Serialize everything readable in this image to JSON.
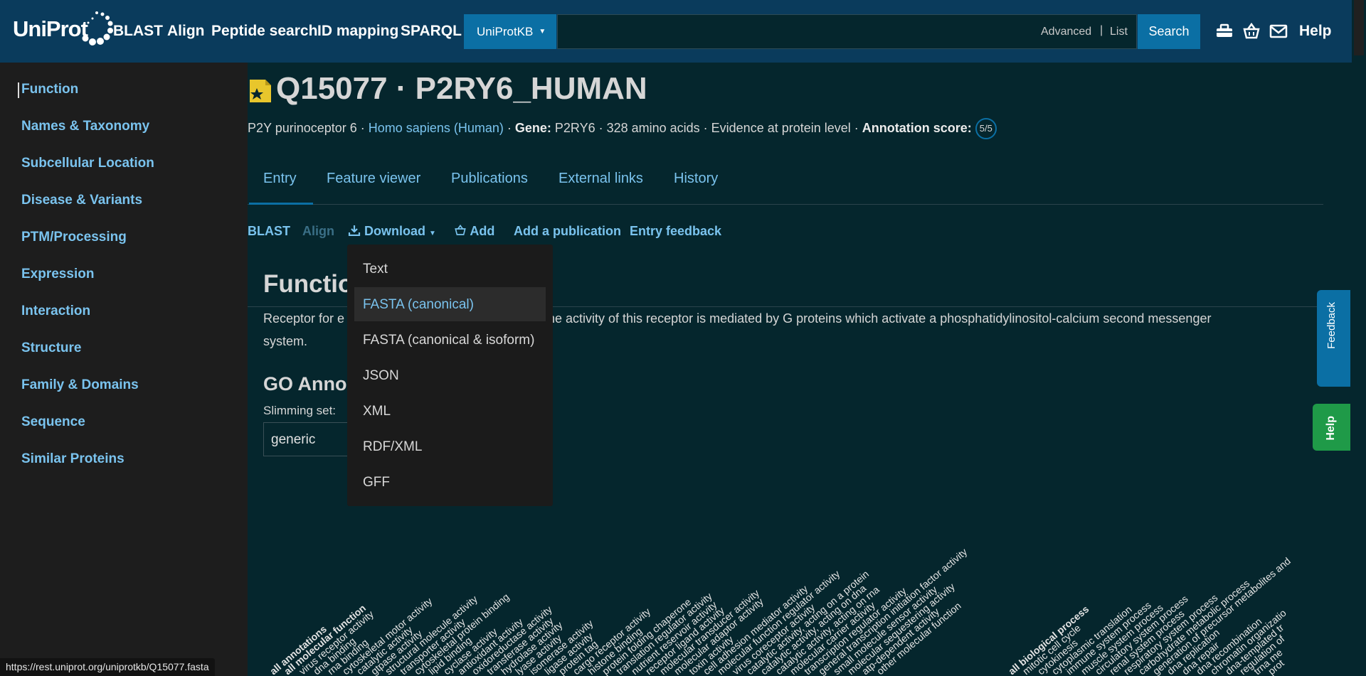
{
  "topbar": {
    "logo_text": "UniProt",
    "nav": [
      "BLAST",
      "Align",
      "Peptide search",
      "ID mapping",
      "SPARQL"
    ],
    "database_select": "UniProtKB",
    "search_value": "",
    "advanced_label": "Advanced",
    "separator": "|",
    "list_label": "List",
    "search_button": "Search",
    "icons": [
      "toolkit-icon",
      "basket-icon",
      "mail-icon"
    ],
    "help_label": "Help"
  },
  "sidebar": {
    "items": [
      "Function",
      "Names & Taxonomy",
      "Subcellular Location",
      "Disease & Variants",
      "PTM/Processing",
      "Expression",
      "Interaction",
      "Structure",
      "Family & Domains",
      "Sequence",
      "Similar Proteins"
    ]
  },
  "entry": {
    "title": "Q15077 · P2RY6_HUMAN",
    "protein_name": "P2Y purinoceptor 6 · ",
    "organism": "Homo sapiens (Human)",
    "gene_prefix": " · ",
    "gene_label": "Gene:",
    "gene_value": " P2RY6 · 328 amino acids · Evidence at protein level · ",
    "annotation_label": "Annotation score:",
    "annotation_score": "5/5"
  },
  "tabs": [
    "Entry",
    "Feature viewer",
    "Publications",
    "External links",
    "History"
  ],
  "toolbar": {
    "blast": "BLAST",
    "align": "Align",
    "download": "Download",
    "add": "Add",
    "add_publication": "Add a publication",
    "entry_feedback": "Entry feedback"
  },
  "download_menu": {
    "items": [
      "Text",
      "FASTA (canonical)",
      "FASTA (canonical & isoform)",
      "JSON",
      "XML",
      "RDF/XML",
      "GFF"
    ],
    "highlighted": "FASTA (canonical)"
  },
  "function": {
    "heading": "Functio",
    "text_part1": "Receptor for e",
    "text_part2": "ne activity of this receptor is mediated by G proteins which activate a phosphatidylinositol-calcium second messenger",
    "text_part3": "system."
  },
  "go": {
    "heading": "GO Anno",
    "slimming_label": "Slimming set:",
    "slimming_value": "generic",
    "labels_mf": [
      "all annotations",
      "all molecular function",
      "virus receptor activity",
      "dna binding",
      "rna binding",
      "cytoskeletal motor activity",
      "catalytic activity",
      "gtpase activity",
      "structural molecule activity",
      "transporter activity",
      "cytoskeletal protein binding",
      "lipid binding",
      "cyclase activity",
      "antioxidant activity",
      "oxidoreductase activity",
      "transferase activity",
      "hydrolase activity",
      "lyase activity",
      "isomerase activity",
      "ligase activity",
      "protein tag",
      "cargo receptor activity",
      "histone binding",
      "protein folding chaperone",
      "translation regulator activity",
      "nutrient reservoir activity",
      "receptor ligand activity",
      "molecular transducer activity",
      "molecular adaptor activity",
      "toxin activity",
      "cell adhesion mediator activity",
      "molecular function regulator activity",
      "virus coreceptor activity",
      "catalytic activity, acting on a protein",
      "catalytic activity, acting on dna",
      "catalytic activity, acting on rna",
      "molecular carrier activity",
      "transcription regulator activity",
      "general transcription initiation factor activity",
      "small molecule sensor activity",
      "molecular sequestering activity",
      "atp-dependent activity",
      "other molecular function"
    ],
    "labels_bp": [
      "all biological process",
      "mitotic cell cycle",
      "cytokinesis",
      "cytoplasmic translation",
      "immune system process",
      "muscle system process",
      "circulatory system process",
      "renal system process",
      "respiratory system process",
      "carbohydrate metabolic process",
      "generation of precursor metabolites and",
      "dna replication",
      "dna repair",
      "dna recombination",
      "chromatin organizatio",
      "dna-templated tr",
      "regulation of",
      "trna me",
      "prot"
    ]
  },
  "side_tabs": {
    "feedback": "Feedback",
    "help": "Help"
  },
  "status_url": "https://rest.uniprot.org/uniprotkb/Q15077.fasta"
}
